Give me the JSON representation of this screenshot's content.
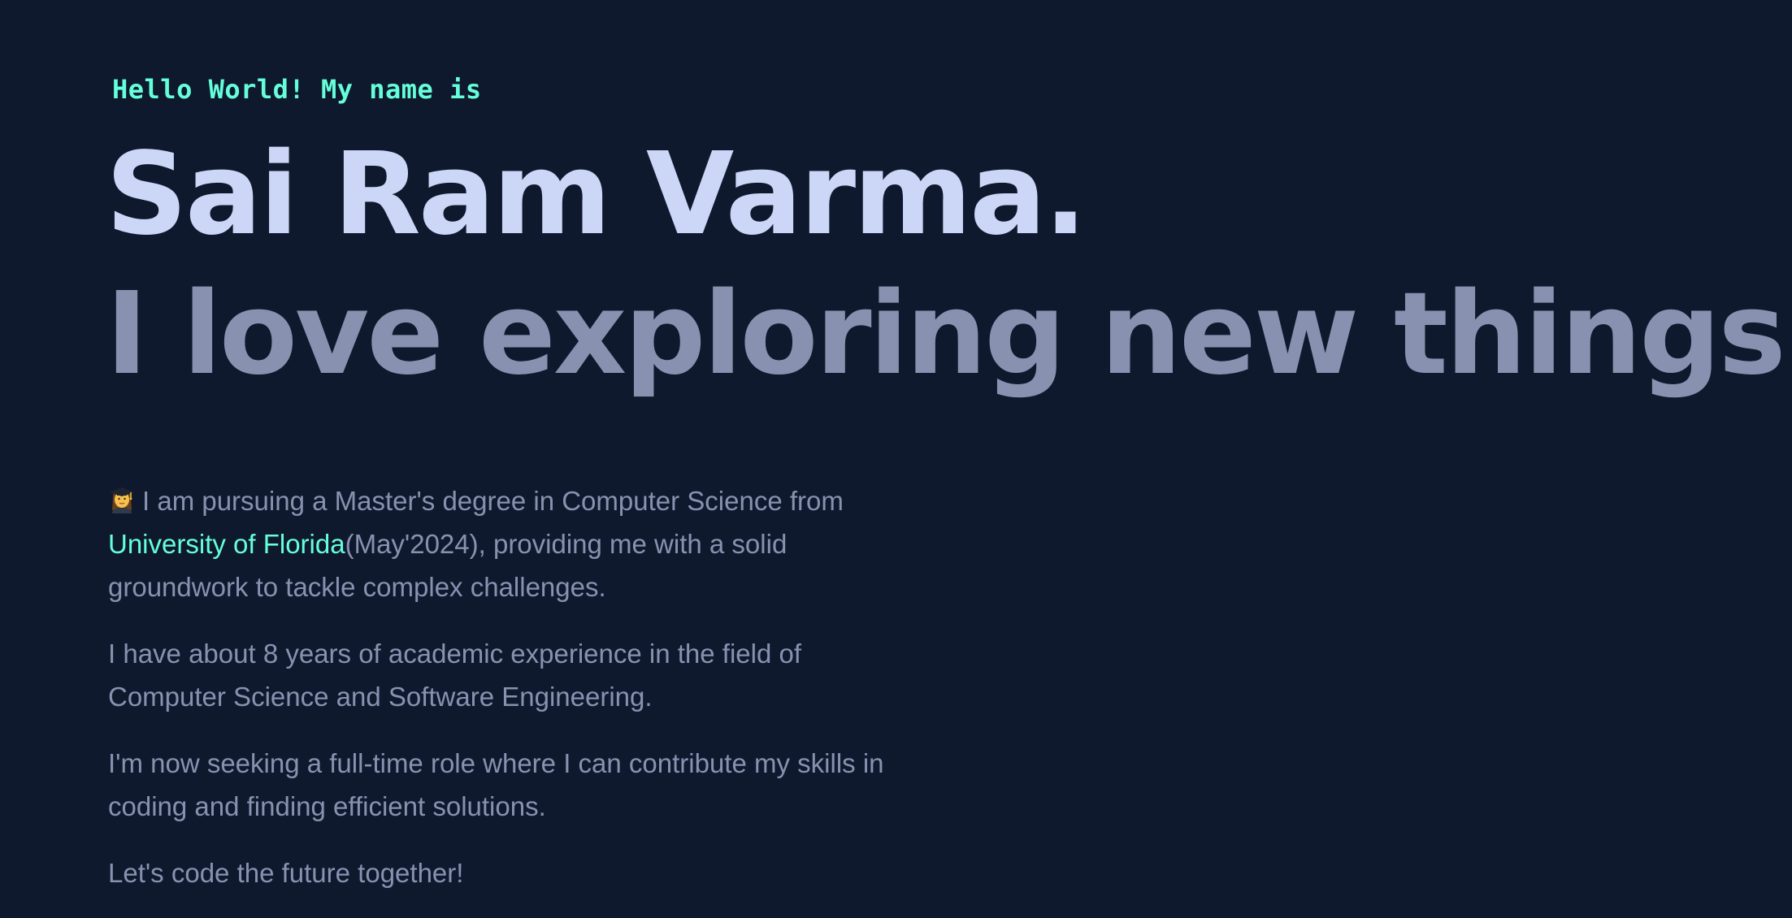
{
  "hero": {
    "greeting": "Hello World! My name is",
    "name": "Sai Ram Varma.",
    "tagline": "I love exploring new things!"
  },
  "about": {
    "p1_text_a": "I am pursuing a Master's degree in Computer Science from",
    "university_link": "University of Florida",
    "p1_text_b": "(May'2024), providing me with a solid groundwork to tackle complex challenges.",
    "p2": "I have about 8 years of academic experience in the field of Computer Science and Software Engineering.",
    "p3": "I'm now seeking a full-time role where I can contribute my skills in coding and finding efficient solutions.",
    "p4": "Let's code the future together!"
  },
  "colors": {
    "background": "#0f192d",
    "accent": "#64ffda",
    "heading": "#ccd6f6",
    "body_text": "#8892b0"
  },
  "icons": {
    "graduate": "woman-student-emoji-icon"
  }
}
